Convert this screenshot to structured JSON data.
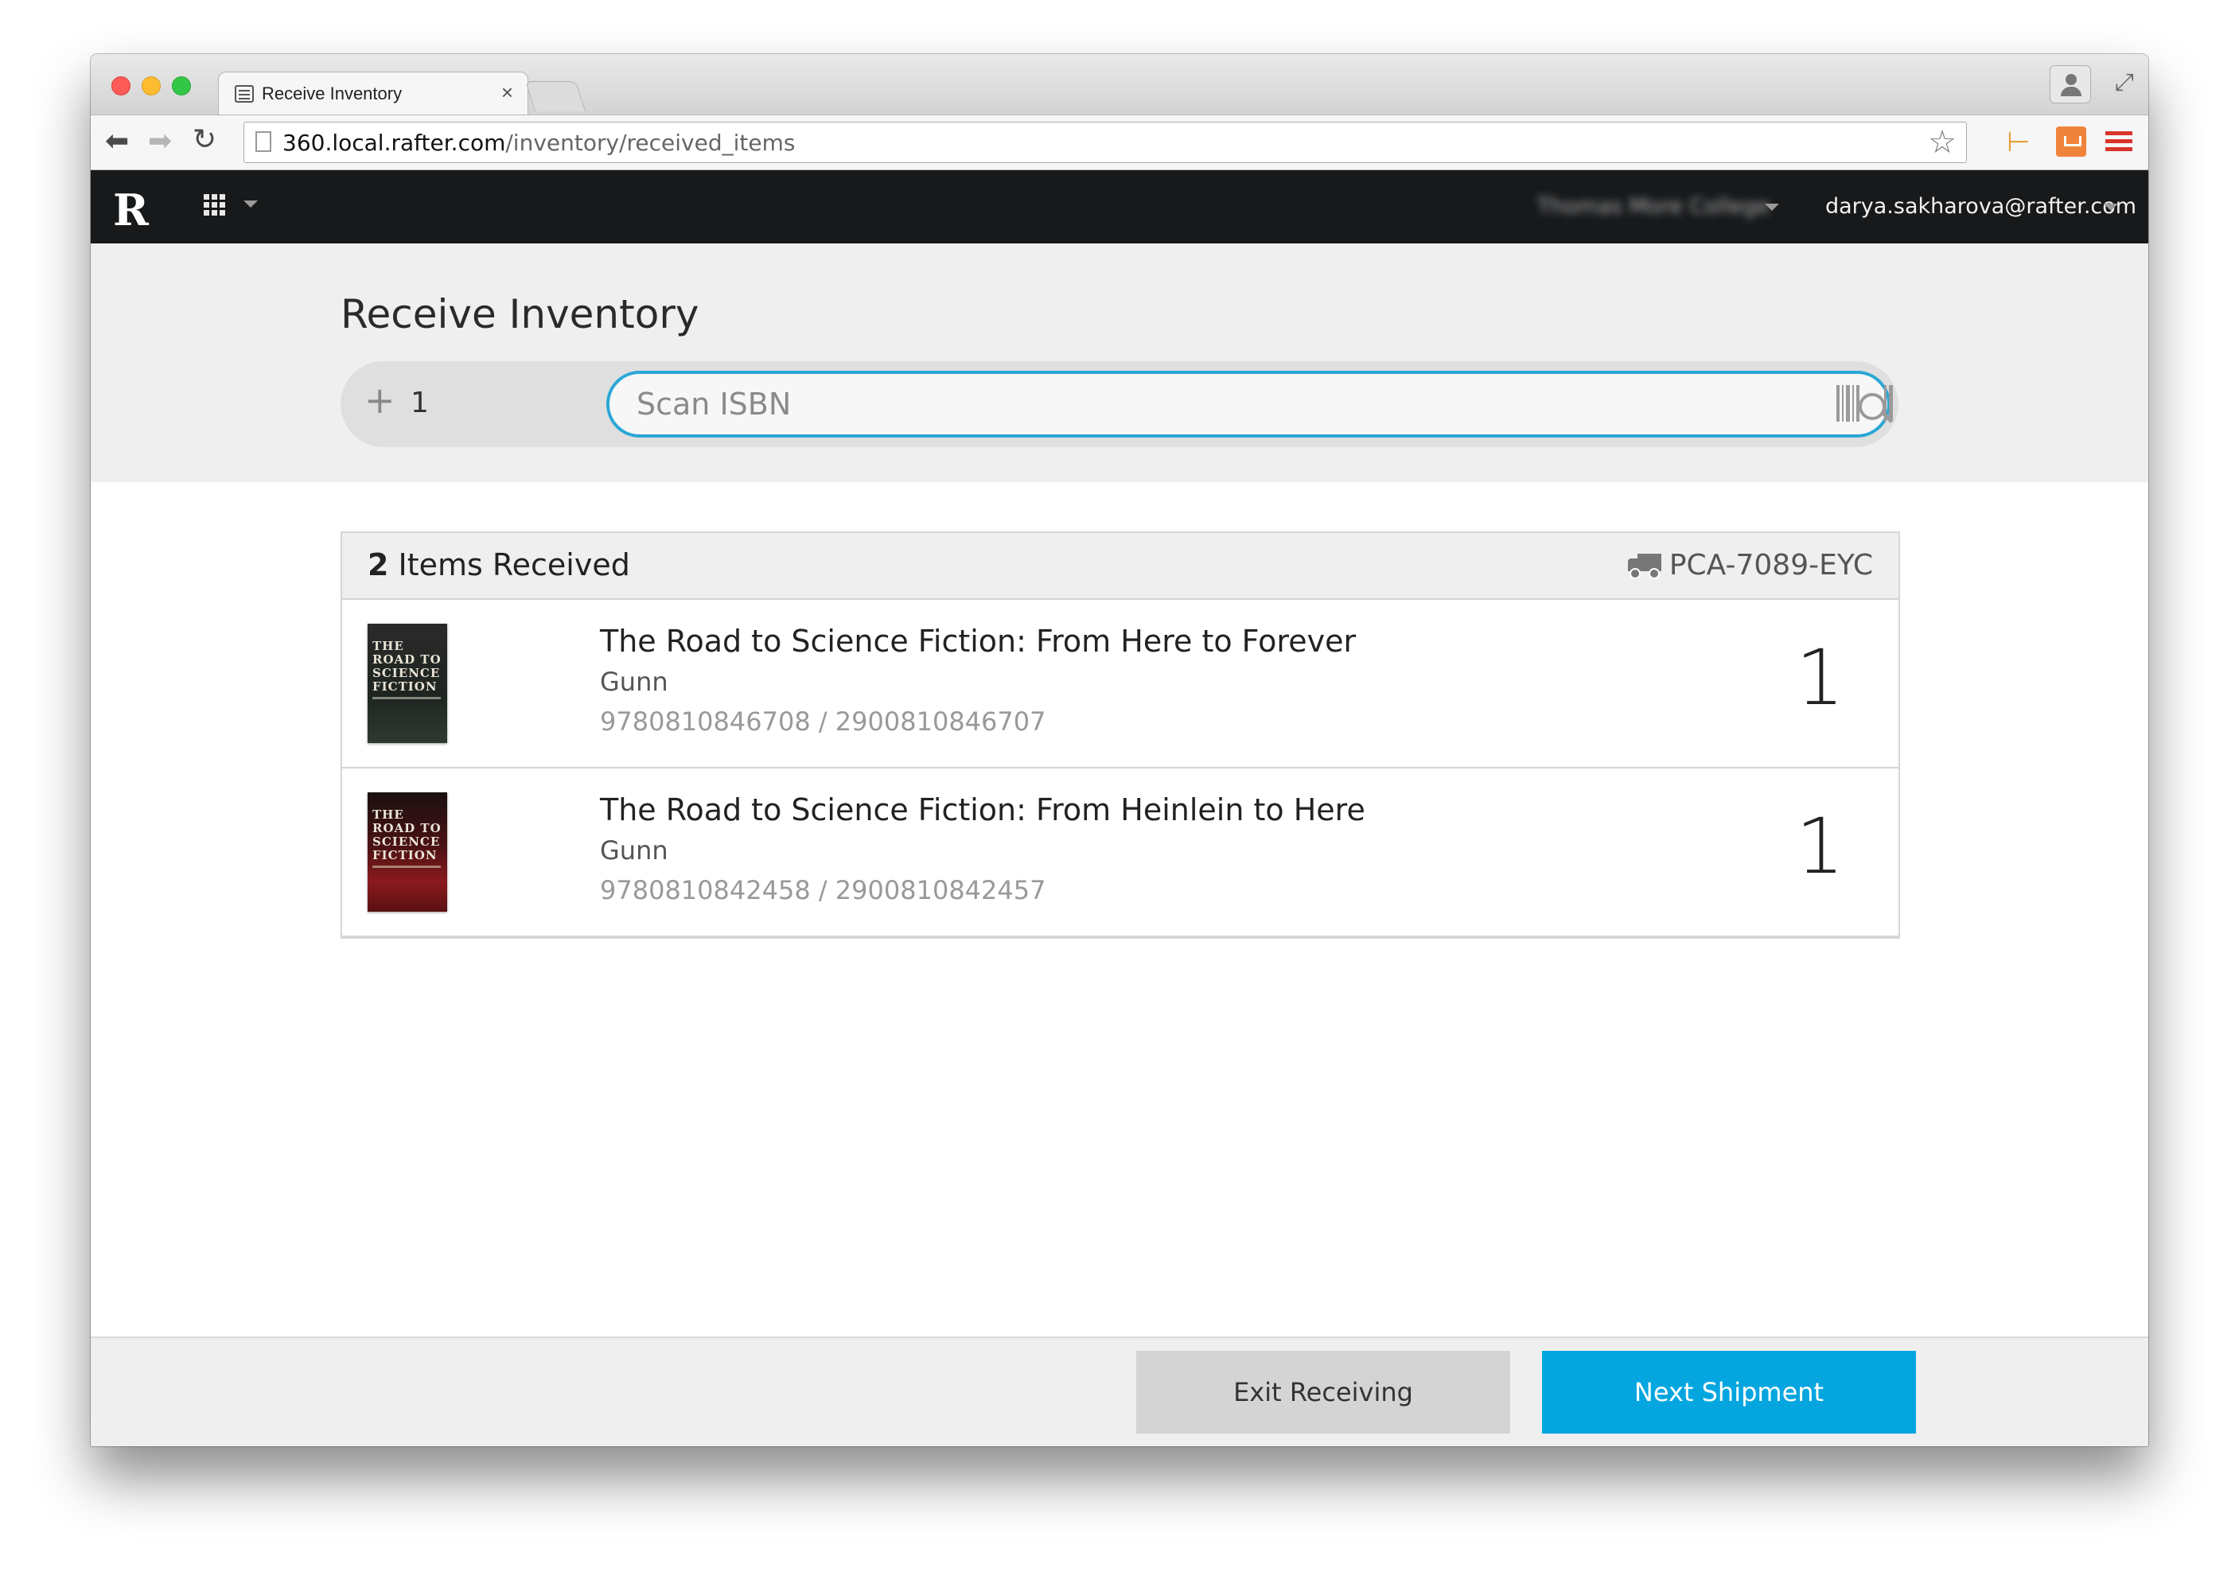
{
  "browser": {
    "tab_title": "Receive Inventory",
    "tab_close": "×",
    "url_host": "360.local.rafter.com",
    "url_path": "/inventory/received_items",
    "back_glyph": "⬅",
    "forward_glyph": "➡",
    "reload_glyph": "↻",
    "bookmark_glyph": "☆",
    "fullscreen_glyph": "⤢",
    "icons": [
      "back-icon",
      "forward-icon",
      "reload-icon",
      "page-icon",
      "star-icon",
      "extension-icon",
      "menu-icon",
      "profile-icon",
      "fullscreen-icon"
    ]
  },
  "appbar": {
    "logo": "R",
    "org_name": "Thomas More College",
    "user_email": "darya.sakharova@rafter.com"
  },
  "page": {
    "title": "Receive Inventory",
    "quantity_plus": "+",
    "quantity": "1",
    "scan_placeholder": "Scan ISBN"
  },
  "received": {
    "count": "2",
    "count_label": "Items Received",
    "shipment_id": "PCA-7089-EYC",
    "items": [
      {
        "cover_text": "THE ROAD TO SCIENCE FICTION",
        "title": "The Road to Science Fiction: From Here to Forever",
        "author": "Gunn",
        "isbns": "9780810846708 / 2900810846707",
        "quantity": "1"
      },
      {
        "cover_text": "THE ROAD TO SCIENCE FICTION",
        "title": "The Road to Science Fiction: From Heinlein to Here",
        "author": "Gunn",
        "isbns": "9780810842458 / 2900810842457",
        "quantity": "1"
      }
    ]
  },
  "footer": {
    "exit_label": "Exit Receiving",
    "next_label": "Next Shipment"
  },
  "colors": {
    "accent": "#05a6e0",
    "input_border": "#2aa7d6",
    "appbar_bg": "#17191b"
  }
}
